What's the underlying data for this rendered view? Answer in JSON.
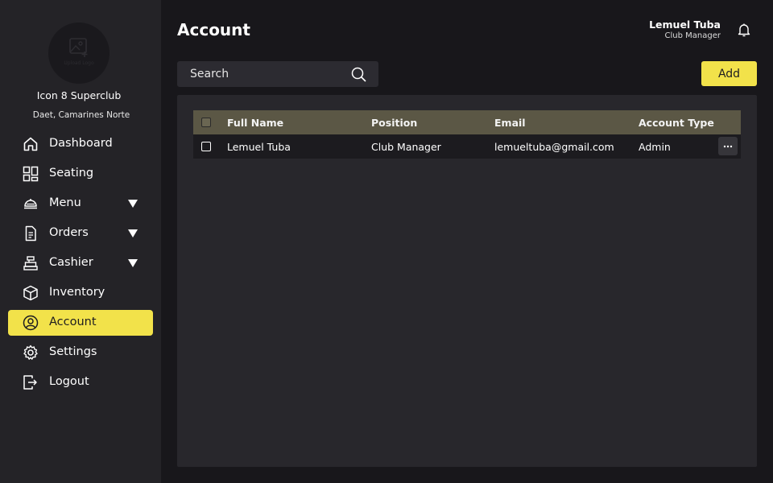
{
  "sidebar": {
    "logo_text": "Upload Logo",
    "club_name": "Icon 8 Superclub",
    "club_location": "Daet, Camarines Norte",
    "items": [
      {
        "label": "Dashboard",
        "icon": "home-icon",
        "caret": false,
        "active": false
      },
      {
        "label": "Seating",
        "icon": "grid-layout-icon",
        "caret": false,
        "active": false
      },
      {
        "label": "Menu",
        "icon": "cloche-icon",
        "caret": true,
        "active": false
      },
      {
        "label": "Orders",
        "icon": "document-icon",
        "caret": true,
        "active": false
      },
      {
        "label": "Cashier",
        "icon": "register-icon",
        "caret": true,
        "active": false
      },
      {
        "label": "Inventory",
        "icon": "box-icon",
        "caret": false,
        "active": false
      },
      {
        "label": "Account",
        "icon": "user-circle-icon",
        "caret": false,
        "active": true
      },
      {
        "label": "Settings",
        "icon": "gear-icon",
        "caret": false,
        "active": false
      },
      {
        "label": "Logout",
        "icon": "logout-icon",
        "caret": false,
        "active": false
      }
    ]
  },
  "header": {
    "title": "Account",
    "user_name": "Lemuel Tuba",
    "user_role": "Club Manager"
  },
  "toolbar": {
    "search_placeholder": "Search",
    "add_label": "Add"
  },
  "table": {
    "columns": [
      "Full Name",
      "Position",
      "Email",
      "Account Type"
    ],
    "rows": [
      {
        "full_name": "Lemuel Tuba",
        "position": "Club Manager",
        "email": "lemueltuba@gmail.com",
        "account_type": "Admin",
        "actions": "···"
      }
    ]
  },
  "colors": {
    "accent": "#f2e24a",
    "sidebar_bg": "#242327",
    "page_bg": "#18171b",
    "panel_bg": "#28272c",
    "table_header_bg": "#5b5745"
  }
}
